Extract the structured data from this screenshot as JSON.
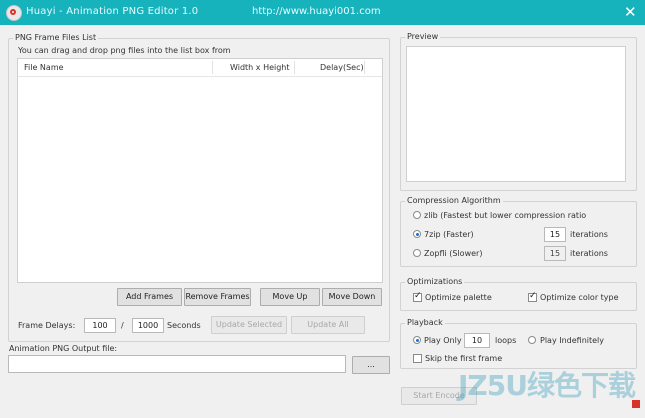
{
  "window": {
    "title": "Huayi - Animation PNG Editor 1.0",
    "url": "http://www.huayi001.com",
    "close_glyph": "✕"
  },
  "frames_group": {
    "label": "PNG Frame Files List",
    "hint": "You can drag and drop png files into the list box from",
    "columns": [
      "File Name",
      "Width x Height",
      "Delay(Sec)"
    ],
    "rows": [],
    "buttons": {
      "add": "Add Frames",
      "remove": "Remove Frames",
      "up": "Move Up",
      "down": "Move Down"
    },
    "frame_delays_label": "Frame Delays:",
    "delay_numerator": "100",
    "slash": "/",
    "delay_denominator": "1000",
    "seconds_label": "Seconds",
    "update_selected": "Update Selected",
    "update_all": "Update All"
  },
  "output": {
    "label": "Animation PNG Output file:",
    "value": "",
    "browse": "..."
  },
  "preview": {
    "label": "Preview"
  },
  "compression": {
    "label": "Compression Algorithm",
    "options": [
      {
        "label": "zlib (Fastest but lower compression ratio",
        "selected": false
      },
      {
        "label": "7zip (Faster)",
        "selected": true,
        "iterations": "15"
      },
      {
        "label": "Zopfli (Slower)",
        "selected": false,
        "iterations": "15"
      }
    ],
    "iterations_label": "iterations"
  },
  "optimizations": {
    "label": "Optimizations",
    "palette": {
      "label": "Optimize palette",
      "checked": true
    },
    "color_type": {
      "label": "Optimize color type",
      "checked": true
    }
  },
  "playback": {
    "label": "Playback",
    "play_only": {
      "label": "Play Only",
      "selected": true
    },
    "loops_value": "10",
    "loops_label": "loops",
    "play_indefinitely": {
      "label": "Play Indefinitely",
      "selected": false
    },
    "skip_first": {
      "label": "Skip the first frame",
      "checked": false
    }
  },
  "footer": {
    "start_encode": "Start Encode"
  },
  "watermark": {
    "text": "JZ5U绿色下载"
  },
  "colors": {
    "titlebar": "#17b3bd",
    "accent_radio": "#1a73c7"
  }
}
